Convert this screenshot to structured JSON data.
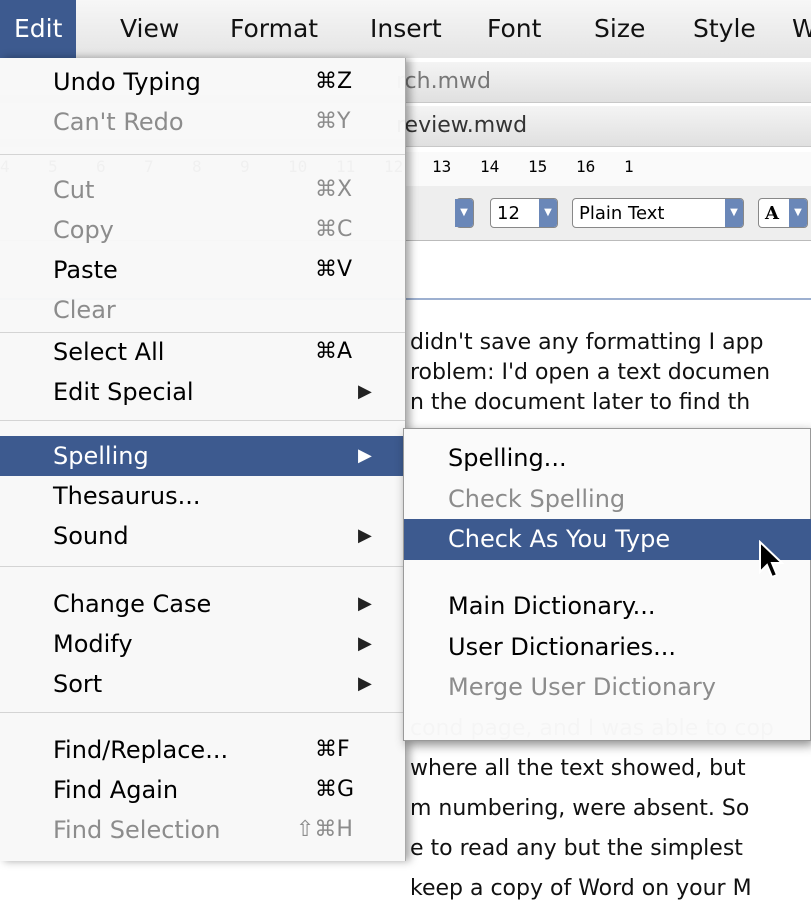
{
  "menubar": {
    "items": [
      "Edit",
      "View",
      "Format",
      "Insert",
      "Font",
      "Size",
      "Style",
      "W"
    ]
  },
  "document": {
    "window_titles": [
      "rch.mwd",
      "review.mwd"
    ],
    "ruler_marks": [
      "4",
      "5",
      "6",
      "7",
      "8",
      "9",
      "10",
      "11",
      "12",
      "13",
      "14",
      "15",
      "16",
      "1"
    ],
    "toolbar": {
      "font_size": "12",
      "style": "Plain Text",
      "font_button": "A"
    },
    "lines": [
      "didn't save any formatting I app",
      "roblem: I'd open a text documen",
      "n the document later to find th",
      "",
      "",
      "",
      "",
      "",
      "",
      "",
      "",
      "",
      "cond page, and I was able to cop",
      "where all the text showed, but",
      "m numbering, were absent. So",
      "e to read any but the simplest",
      "keep a copy of Word on your M"
    ]
  },
  "edit_menu": {
    "items": [
      {
        "label": "Undo Typing",
        "shortcut": "⌘Z",
        "enabled": true
      },
      {
        "label": "Can't Redo",
        "shortcut": "⌘Y",
        "enabled": false
      },
      {
        "label": "Cut",
        "shortcut": "⌘X",
        "enabled": false
      },
      {
        "label": "Copy",
        "shortcut": "⌘C",
        "enabled": false
      },
      {
        "label": "Paste",
        "shortcut": "⌘V",
        "enabled": true
      },
      {
        "label": "Clear",
        "shortcut": "",
        "enabled": false
      },
      {
        "label": "Select All",
        "shortcut": "⌘A",
        "enabled": true
      },
      {
        "label": "Edit Special",
        "shortcut": "",
        "enabled": true,
        "submenu": true
      },
      {
        "label": "Spelling",
        "shortcut": "",
        "enabled": true,
        "submenu": true,
        "highlighted": true
      },
      {
        "label": "Thesaurus...",
        "shortcut": "",
        "enabled": true
      },
      {
        "label": "Sound",
        "shortcut": "",
        "enabled": true,
        "submenu": true
      },
      {
        "label": "Change Case",
        "shortcut": "",
        "enabled": true,
        "submenu": true
      },
      {
        "label": "Modify",
        "shortcut": "",
        "enabled": true,
        "submenu": true
      },
      {
        "label": "Sort",
        "shortcut": "",
        "enabled": true,
        "submenu": true
      },
      {
        "label": "Find/Replace...",
        "shortcut": "⌘F",
        "enabled": true
      },
      {
        "label": "Find Again",
        "shortcut": "⌘G",
        "enabled": true
      },
      {
        "label": "Find Selection",
        "shortcut": "⇧⌘H",
        "enabled": false
      }
    ]
  },
  "spelling_submenu": {
    "items": [
      {
        "label": "Spelling...",
        "enabled": true
      },
      {
        "label": "Check Spelling",
        "enabled": false
      },
      {
        "label": "Check As You Type",
        "enabled": true,
        "highlighted": true
      },
      {
        "label": "Main Dictionary...",
        "enabled": true
      },
      {
        "label": "User Dictionaries...",
        "enabled": true
      },
      {
        "label": "Merge User Dictionary",
        "enabled": false
      }
    ]
  },
  "icons": {
    "submenu_arrow": "triangle-right-icon",
    "cursor": "arrow-pointer-icon"
  },
  "colors": {
    "highlight": "#3d5a8f"
  }
}
